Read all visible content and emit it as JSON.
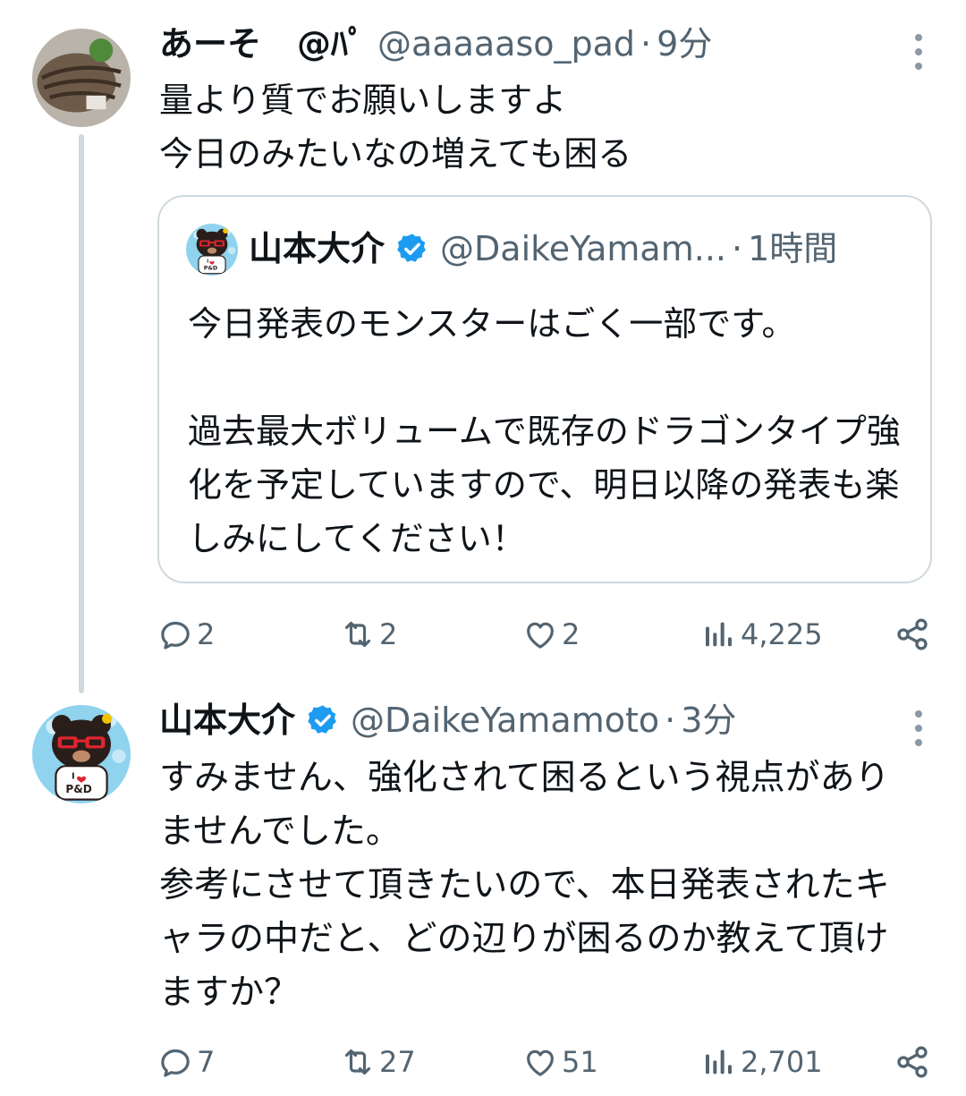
{
  "tweets": [
    {
      "author": {
        "name": "あーそ",
        "badge": "@ﾊﾟ",
        "handle": "@aaaaaso_pad",
        "time": "9分",
        "avatar": "food-photo-avatar"
      },
      "text": "量より質でお願いしますよ\n今日のみたいなの増えても困る",
      "quote": {
        "author": {
          "name": "山本大介",
          "handle": "@DaikeYamam...",
          "time": "1時間",
          "verified": true,
          "avatar": "bear-mascot-avatar"
        },
        "text": "今日発表のモンスターはごく一部です。\n\n過去最大ボリュームで既存のドラゴンタイプ強化を予定していますので、明日以降の発表も楽しみにしてください！"
      },
      "stats": {
        "replies": "2",
        "retweets": "2",
        "likes": "2",
        "views": "4,225"
      }
    },
    {
      "author": {
        "name": "山本大介",
        "handle": "@DaikeYamamoto",
        "time": "3分",
        "verified": true,
        "avatar": "bear-mascot-avatar"
      },
      "text": "すみません、強化されて困るという視点がありませんでした。\n参考にさせて頂きたいので、本日発表されたキャラの中だと、どの辺りが困るのか教えて頂けますか？",
      "stats": {
        "replies": "7",
        "retweets": "27",
        "likes": "51",
        "views": "2,701"
      }
    }
  ],
  "ui": {
    "separator": "·",
    "accent": "#1d9bf0",
    "muted": "#536471",
    "border": "#cfd9de"
  }
}
